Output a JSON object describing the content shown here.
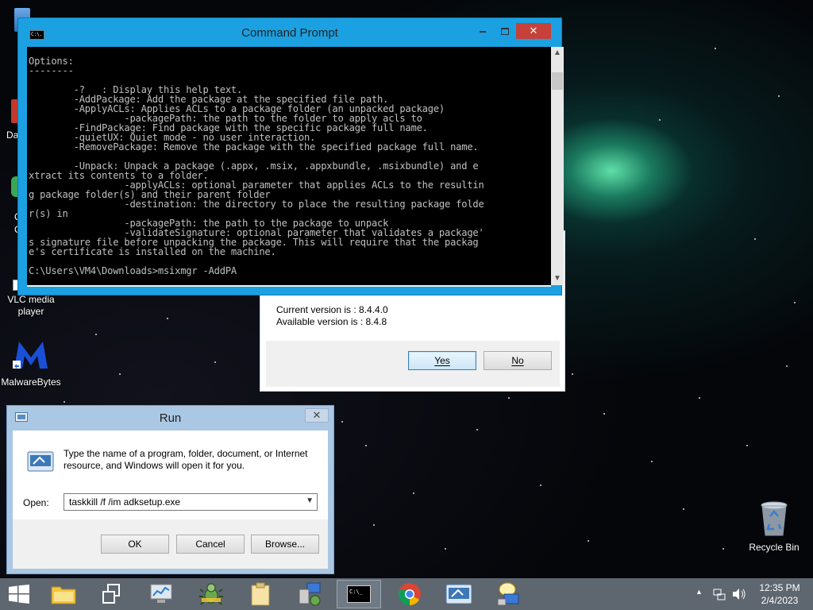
{
  "desktop": {
    "icons": [
      {
        "label": "VLC media player",
        "line1": "VLC media",
        "line2": "player"
      },
      {
        "label": "MalwareBytes"
      },
      {
        "label": "Recycle Bin"
      }
    ],
    "edge_labels": [
      "Da",
      "C",
      "C"
    ]
  },
  "cmd": {
    "title": "Command Prompt",
    "icon_text": "C:\\.",
    "lines": [
      "",
      "Options:",
      "--------",
      "",
      "        -?   : Display this help text.",
      "        -AddPackage: Add the package at the specified file path.",
      "        -ApplyACLs: Applies ACLs to a package folder (an unpacked package)",
      "                 -packagePath: the path to the folder to apply acls to",
      "        -FindPackage: Find package with the specific package full name.",
      "        -quietUX: Quiet mode - no user interaction.",
      "        -RemovePackage: Remove the package with the specified package full name.",
      "",
      "        -Unpack: Unpack a package (.appx, .msix, .appxbundle, .msixbundle) and e",
      "xtract its contents to a folder.",
      "                 -applyACLs: optional parameter that applies ACLs to the resultin",
      "g package folder(s) and their parent folder",
      "                 -destination: the directory to place the resulting package folde",
      "r(s) in",
      "                 -packagePath: the path to the package to unpack",
      "                 -validateSignature: optional parameter that validates a package'",
      "s signature file before unpacking the package. This will require that the packag",
      "e's certificate is installed on the machine.",
      "",
      "C:\\Users\\VM4\\Downloads>msixmgr -AddPA"
    ]
  },
  "update_dialog": {
    "current_version": "Current version is  : 8.4.4.0",
    "available_version": "Available version is : 8.4.8",
    "yes_label": "Yes",
    "no_label": "No"
  },
  "run": {
    "title": "Run",
    "close_glyph": "✕",
    "description": "Type the name of a program, folder, document, or Internet resource, and Windows will open it for you.",
    "open_label": "Open:",
    "command_value": "taskkill /f /im adksetup.exe",
    "ok_label": "OK",
    "cancel_label": "Cancel",
    "browse_label": "Browse..."
  },
  "taskbar": {
    "items": [
      "Start",
      "File Explorer",
      "Task View",
      "Performance Monitor",
      "Bug Tool",
      "Notes",
      "Network Setup",
      "Command Prompt",
      "Google Chrome",
      "Remote Desktop",
      "Network Share"
    ],
    "active": "Command Prompt",
    "clock_time": "12:35 PM",
    "clock_date": "2/4/2023"
  },
  "colors": {
    "accent_blue": "#1ba1e2",
    "close_red": "#c7403a",
    "taskbar": "#5e6670"
  }
}
